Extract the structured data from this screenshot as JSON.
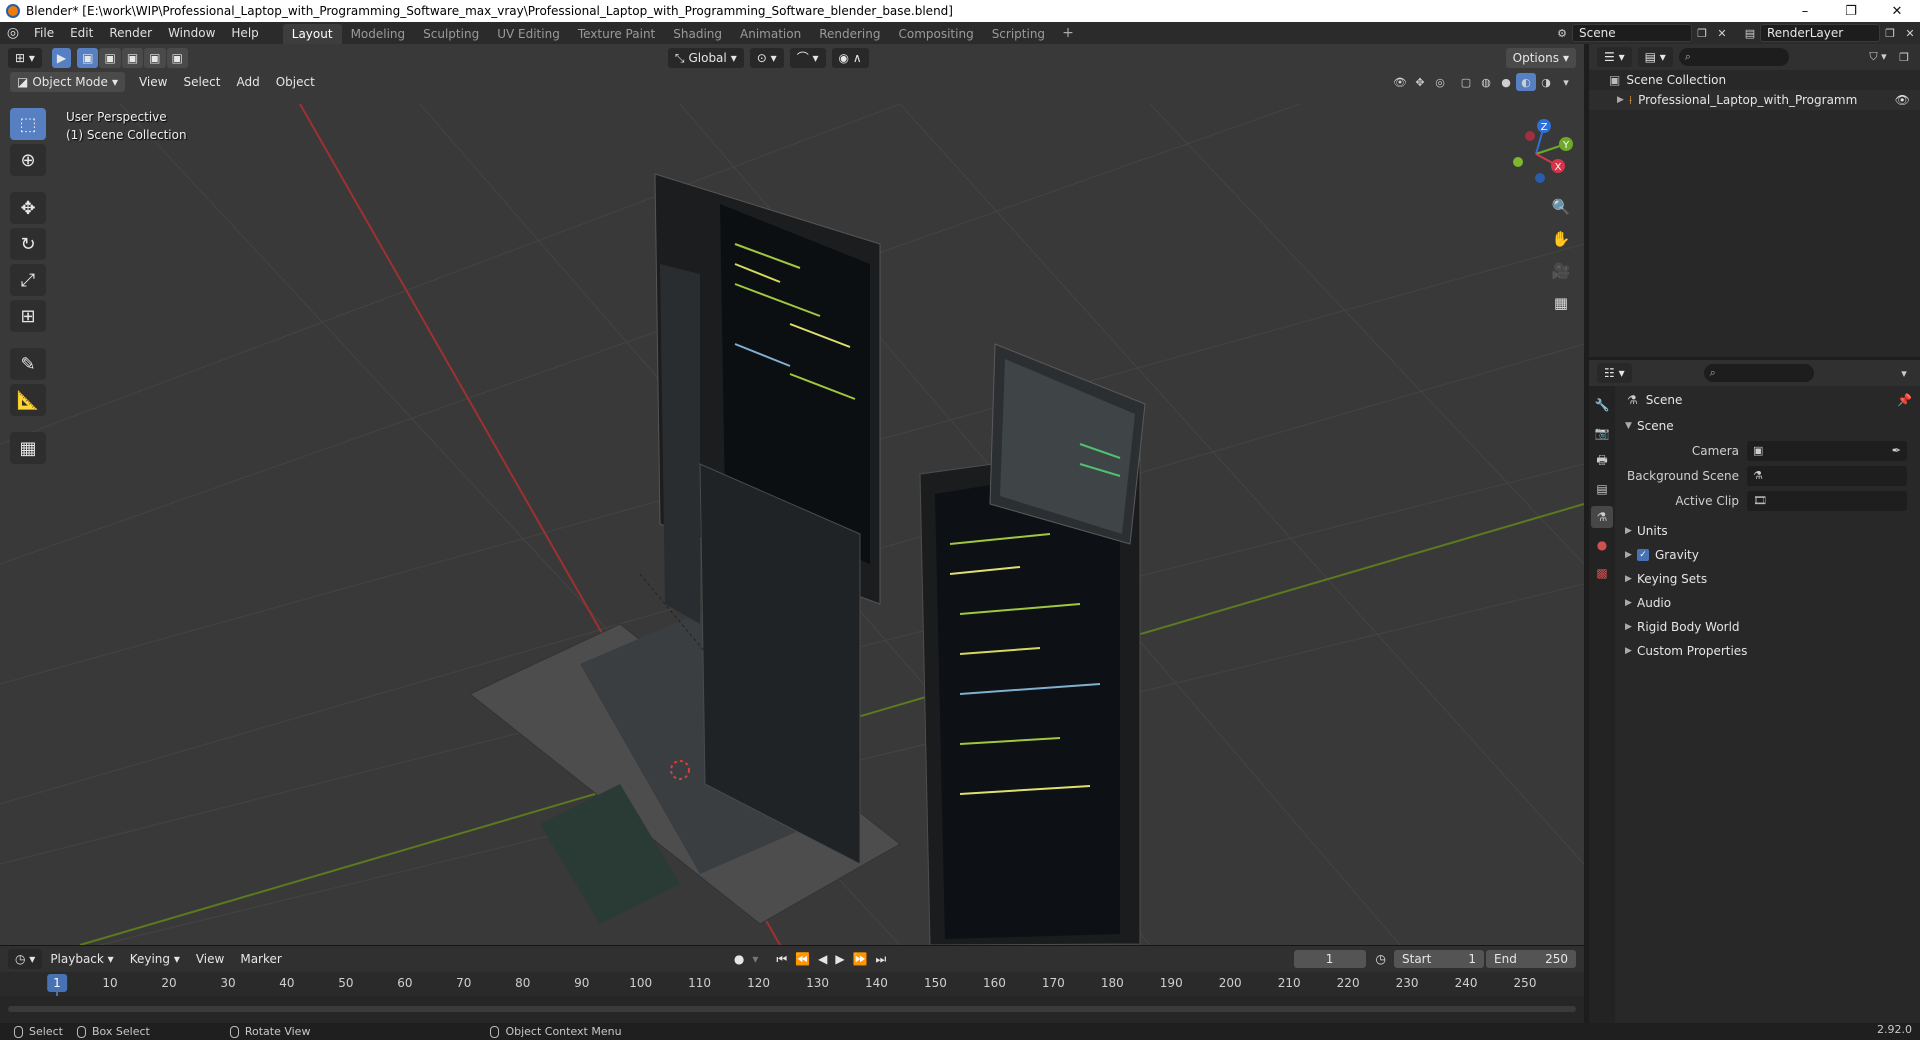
{
  "window": {
    "title": "Blender* [E:\\work\\WIP\\Professional_Laptop_with_Programming_Software_max_vray\\Professional_Laptop_with_Programming_Software_blender_base.blend]",
    "minimize": "–",
    "maximize": "❐",
    "close": "✕"
  },
  "menu": [
    "File",
    "Edit",
    "Render",
    "Window",
    "Help"
  ],
  "workspaces": [
    "Layout",
    "Modeling",
    "Sculpting",
    "UV Editing",
    "Texture Paint",
    "Shading",
    "Animation",
    "Rendering",
    "Compositing",
    "Scripting"
  ],
  "active_workspace": "Layout",
  "topbar_right": {
    "scene": "Scene",
    "render_layer": "RenderLayer"
  },
  "viewport": {
    "transform_orientation": "Global",
    "options": "Options",
    "mode": "Object Mode",
    "header_menu": [
      "View",
      "Select",
      "Add",
      "Object"
    ],
    "perspective": "User Perspective",
    "collection": "(1) Scene Collection",
    "gizmo": {
      "z": "Z",
      "y": "Y",
      "x": "X"
    }
  },
  "timeline": {
    "menus": [
      "Playback",
      "Keying",
      "View",
      "Marker"
    ],
    "current_frame": "1",
    "start_label": "Start",
    "start": "1",
    "end_label": "End",
    "end": "250",
    "ticks": [
      "1",
      "10",
      "20",
      "30",
      "40",
      "50",
      "60",
      "70",
      "80",
      "90",
      "100",
      "110",
      "120",
      "130",
      "140",
      "150",
      "160",
      "170",
      "180",
      "190",
      "200",
      "210",
      "220",
      "230",
      "240",
      "250"
    ]
  },
  "status": {
    "select": "Select",
    "box_select": "Box Select",
    "rotate": "Rotate View",
    "context": "Object Context Menu",
    "version": "2.92.0"
  },
  "outliner": {
    "root": "Scene Collection",
    "items": [
      "Professional_Laptop_with_Programming_Soft"
    ]
  },
  "properties": {
    "context": "Scene",
    "panel": "Scene",
    "fields": [
      {
        "label": "Camera"
      },
      {
        "label": "Background Scene"
      },
      {
        "label": "Active Clip"
      }
    ],
    "subpanels": [
      "Units",
      "Gravity",
      "Keying Sets",
      "Audio",
      "Rigid Body World",
      "Custom Properties"
    ]
  }
}
